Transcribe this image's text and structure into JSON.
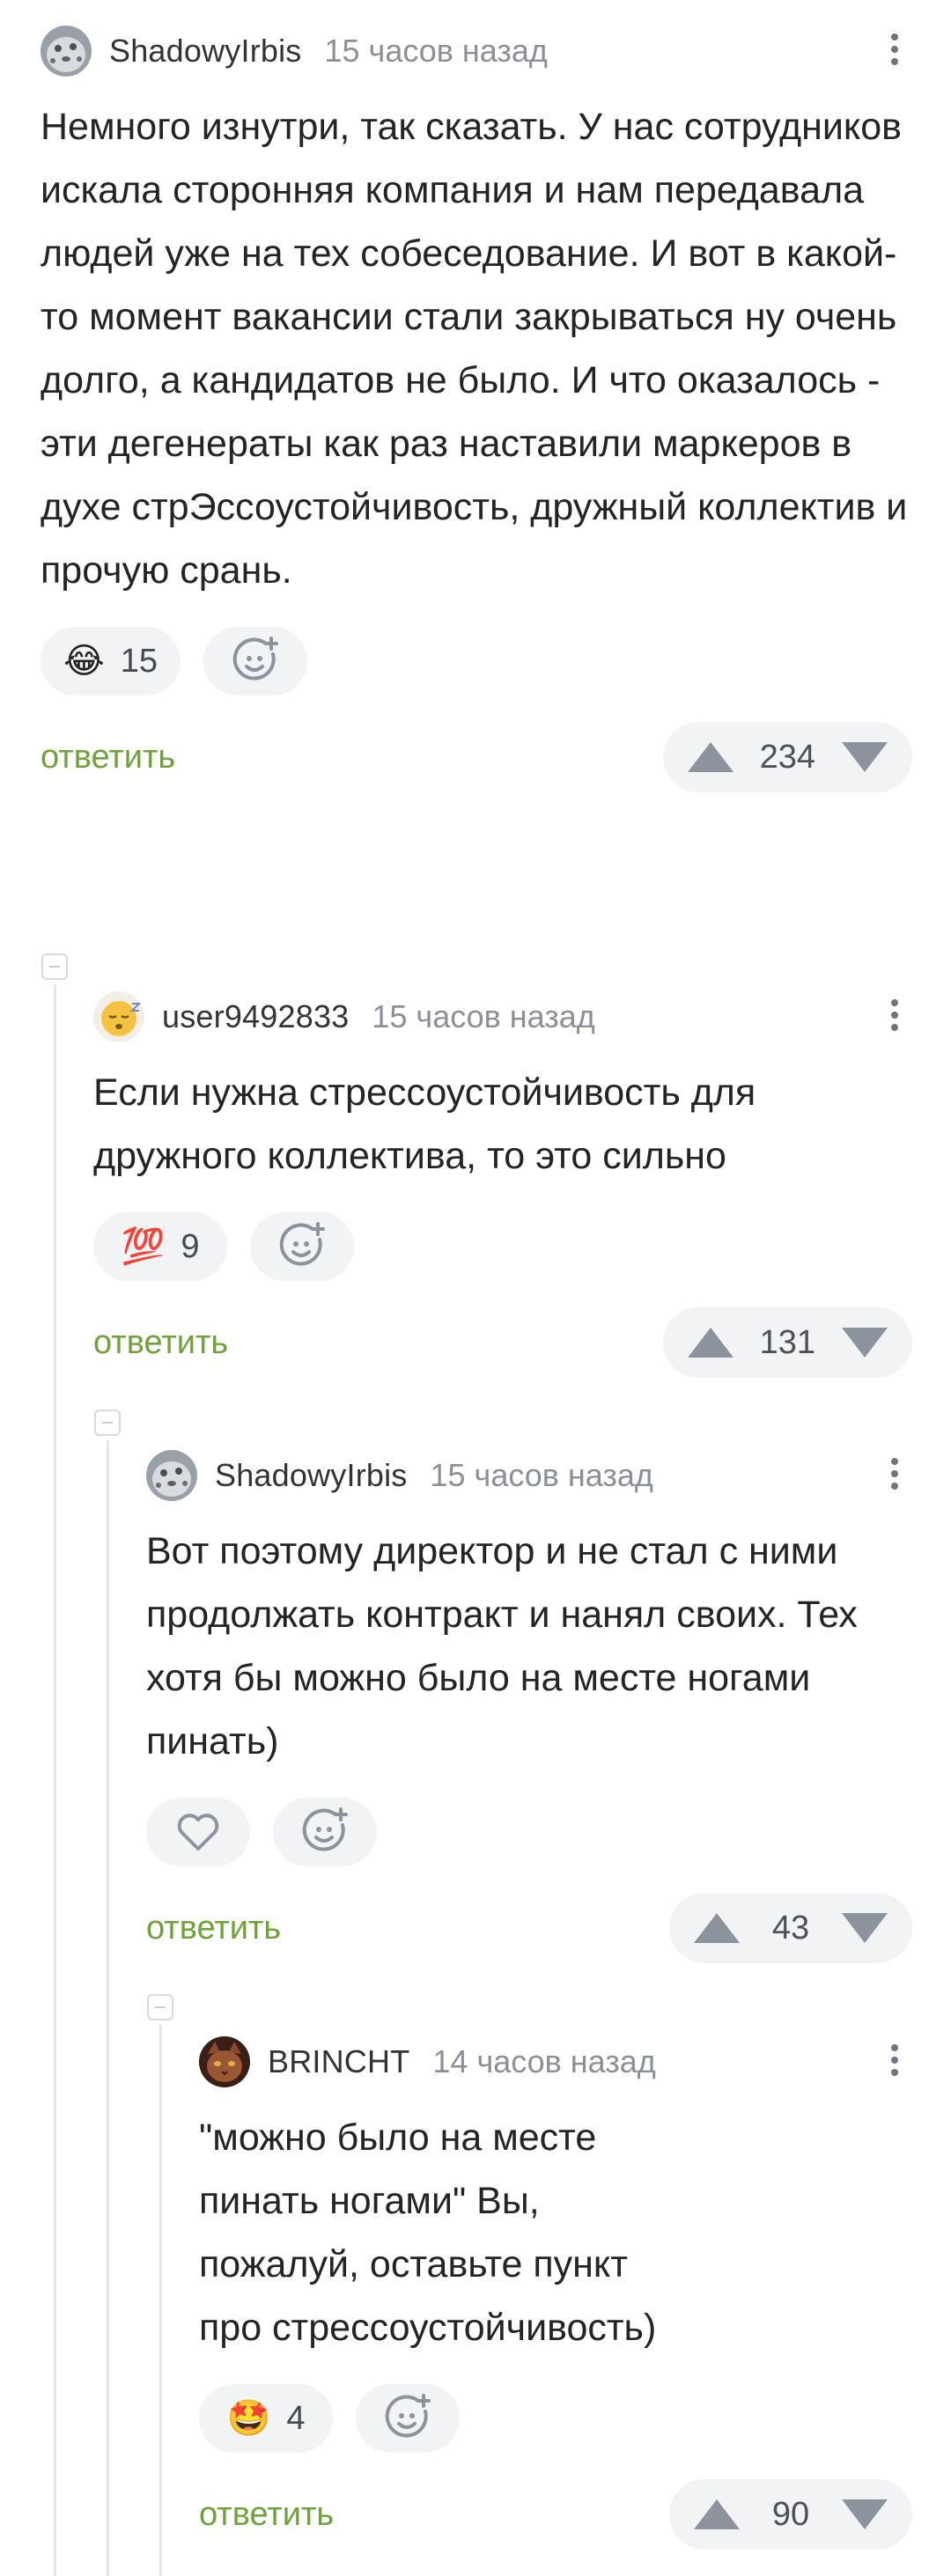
{
  "comments": [
    {
      "username": "ShadowyIrbis",
      "time": "15 часов назад",
      "text": "Немного изнутри, так сказать. У нас сотрудников искала сторонняя компания и нам передавала людей уже на тех собеседование. И вот в какой-то момент вакансии стали закрываться ну очень долго, а кандидатов не было. И что оказалось - эти дегенераты как раз наставили маркеров в духе стрЭссоустойчивость, дружный коллектив и прочую срань.",
      "reaction": {
        "emoji": "😂",
        "count": "15"
      },
      "reply_label": "ответить",
      "score": "234",
      "avatar_icon": "snow-leopard-avatar"
    },
    {
      "username": "user9492833",
      "time": "15 часов назад",
      "text": "Если нужна стрессоустойчивость для дружного коллектива, то это сильно",
      "reaction": {
        "emoji": "💯",
        "count": "9"
      },
      "reply_label": "ответить",
      "score": "131",
      "avatar_icon": "sleepy-face-avatar"
    },
    {
      "username": "ShadowyIrbis",
      "time": "15 часов назад",
      "text": "Вот поэтому директор и не стал с ними продолжать контракт и нанял своих. Тех хотя бы можно было на месте ногами пинать)",
      "reply_label": "ответить",
      "score": "43",
      "avatar_icon": "snow-leopard-avatar"
    },
    {
      "username": "BRINCHT",
      "time": "14 часов назад",
      "text": "\"можно было на месте пинать ногами\" Вы, пожалуй, оставьте пункт про стрессоустойчивость)",
      "reaction": {
        "emoji": "🤩",
        "count": "4"
      },
      "reply_label": "ответить",
      "score": "90",
      "avatar_icon": "cat-avatar"
    }
  ],
  "colors": {
    "reply_link": "#6ea33a",
    "pill_bg": "#f2f3f5",
    "vote_arrow": "#8d939c",
    "thread_line": "#e4e6ea"
  },
  "icons": [
    "more-vertical-icon",
    "add-reaction-icon",
    "heart-icon",
    "upvote-arrow-icon",
    "downvote-arrow-icon",
    "collapse-thread-icon"
  ]
}
